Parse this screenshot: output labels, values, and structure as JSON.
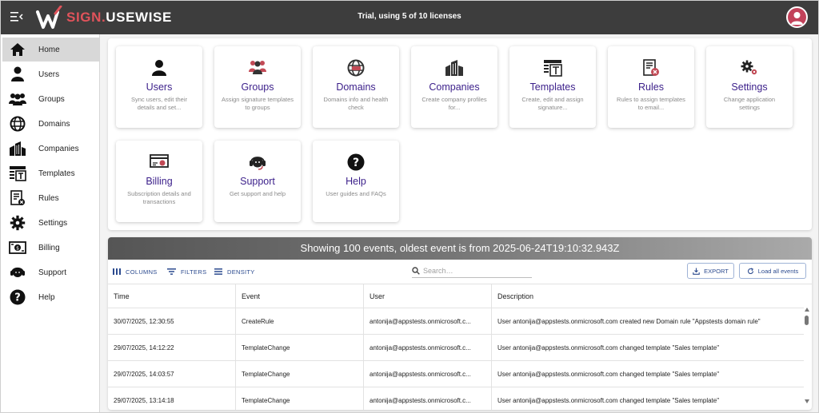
{
  "header": {
    "brand_part1": "SIGN.",
    "brand_part2": "USEWISE",
    "license_status": "Trial, using 5 of 10 licenses"
  },
  "sidebar": {
    "items": [
      {
        "label": "Home",
        "icon": "home-icon",
        "active": true
      },
      {
        "label": "Users",
        "icon": "user-icon"
      },
      {
        "label": "Groups",
        "icon": "groups-icon"
      },
      {
        "label": "Domains",
        "icon": "globe-icon"
      },
      {
        "label": "Companies",
        "icon": "building-icon"
      },
      {
        "label": "Templates",
        "icon": "template-icon"
      },
      {
        "label": "Rules",
        "icon": "rules-icon"
      },
      {
        "label": "Settings",
        "icon": "gear-icon"
      },
      {
        "label": "Billing",
        "icon": "billing-icon"
      },
      {
        "label": "Support",
        "icon": "headset-icon"
      },
      {
        "label": "Help",
        "icon": "help-icon"
      }
    ]
  },
  "tiles": [
    {
      "title": "Users",
      "desc": "Sync users, edit their details and set..."
    },
    {
      "title": "Groups",
      "desc": "Assign signature templates to groups"
    },
    {
      "title": "Domains",
      "desc": "Domains info and health check"
    },
    {
      "title": "Companies",
      "desc": "Create company profiles for..."
    },
    {
      "title": "Templates",
      "desc": "Create, edit and assign signature..."
    },
    {
      "title": "Rules",
      "desc": "Rules to assign templates to email..."
    },
    {
      "title": "Settings",
      "desc": "Change application settings"
    },
    {
      "title": "Billing",
      "desc": "Subscription details and transactions"
    },
    {
      "title": "Support",
      "desc": "Get support and help"
    },
    {
      "title": "Help",
      "desc": "User guides and FAQs"
    }
  ],
  "events": {
    "header": "Showing 100 events, oldest event is from 2025-06-24T19:10:32.943Z",
    "toolbar": {
      "columns": "COLUMNS",
      "filters": "FILTERS",
      "density": "DENSITY",
      "search_placeholder": "Search…",
      "export": "EXPORT",
      "load_all": "Load all events"
    },
    "columns": [
      "Time",
      "Event",
      "User",
      "Description"
    ],
    "rows": [
      [
        "30/07/2025, 12:30:55",
        "CreateRule",
        "antonija@appstests.onmicrosoft.c...",
        "User antonija@appstests.onmicrosoft.com created new Domain rule \"Appstests domain rule\""
      ],
      [
        "29/07/2025, 14:12:22",
        "TemplateChange",
        "antonija@appstests.onmicrosoft.c...",
        "User antonija@appstests.onmicrosoft.com changed template \"Sales template\""
      ],
      [
        "29/07/2025, 14:03:57",
        "TemplateChange",
        "antonija@appstests.onmicrosoft.c...",
        "User antonija@appstests.onmicrosoft.com changed template \"Sales template\""
      ],
      [
        "29/07/2025, 13:14:18",
        "TemplateChange",
        "antonija@appstests.onmicrosoft.c...",
        "User antonija@appstests.onmicrosoft.com changed template \"Sales template\""
      ]
    ]
  },
  "colors": {
    "topbar": "#3d3d3d",
    "brand_accent": "#e0535b",
    "tile_title": "#3b1f8a",
    "toolbar_text": "#2c4b8f"
  }
}
